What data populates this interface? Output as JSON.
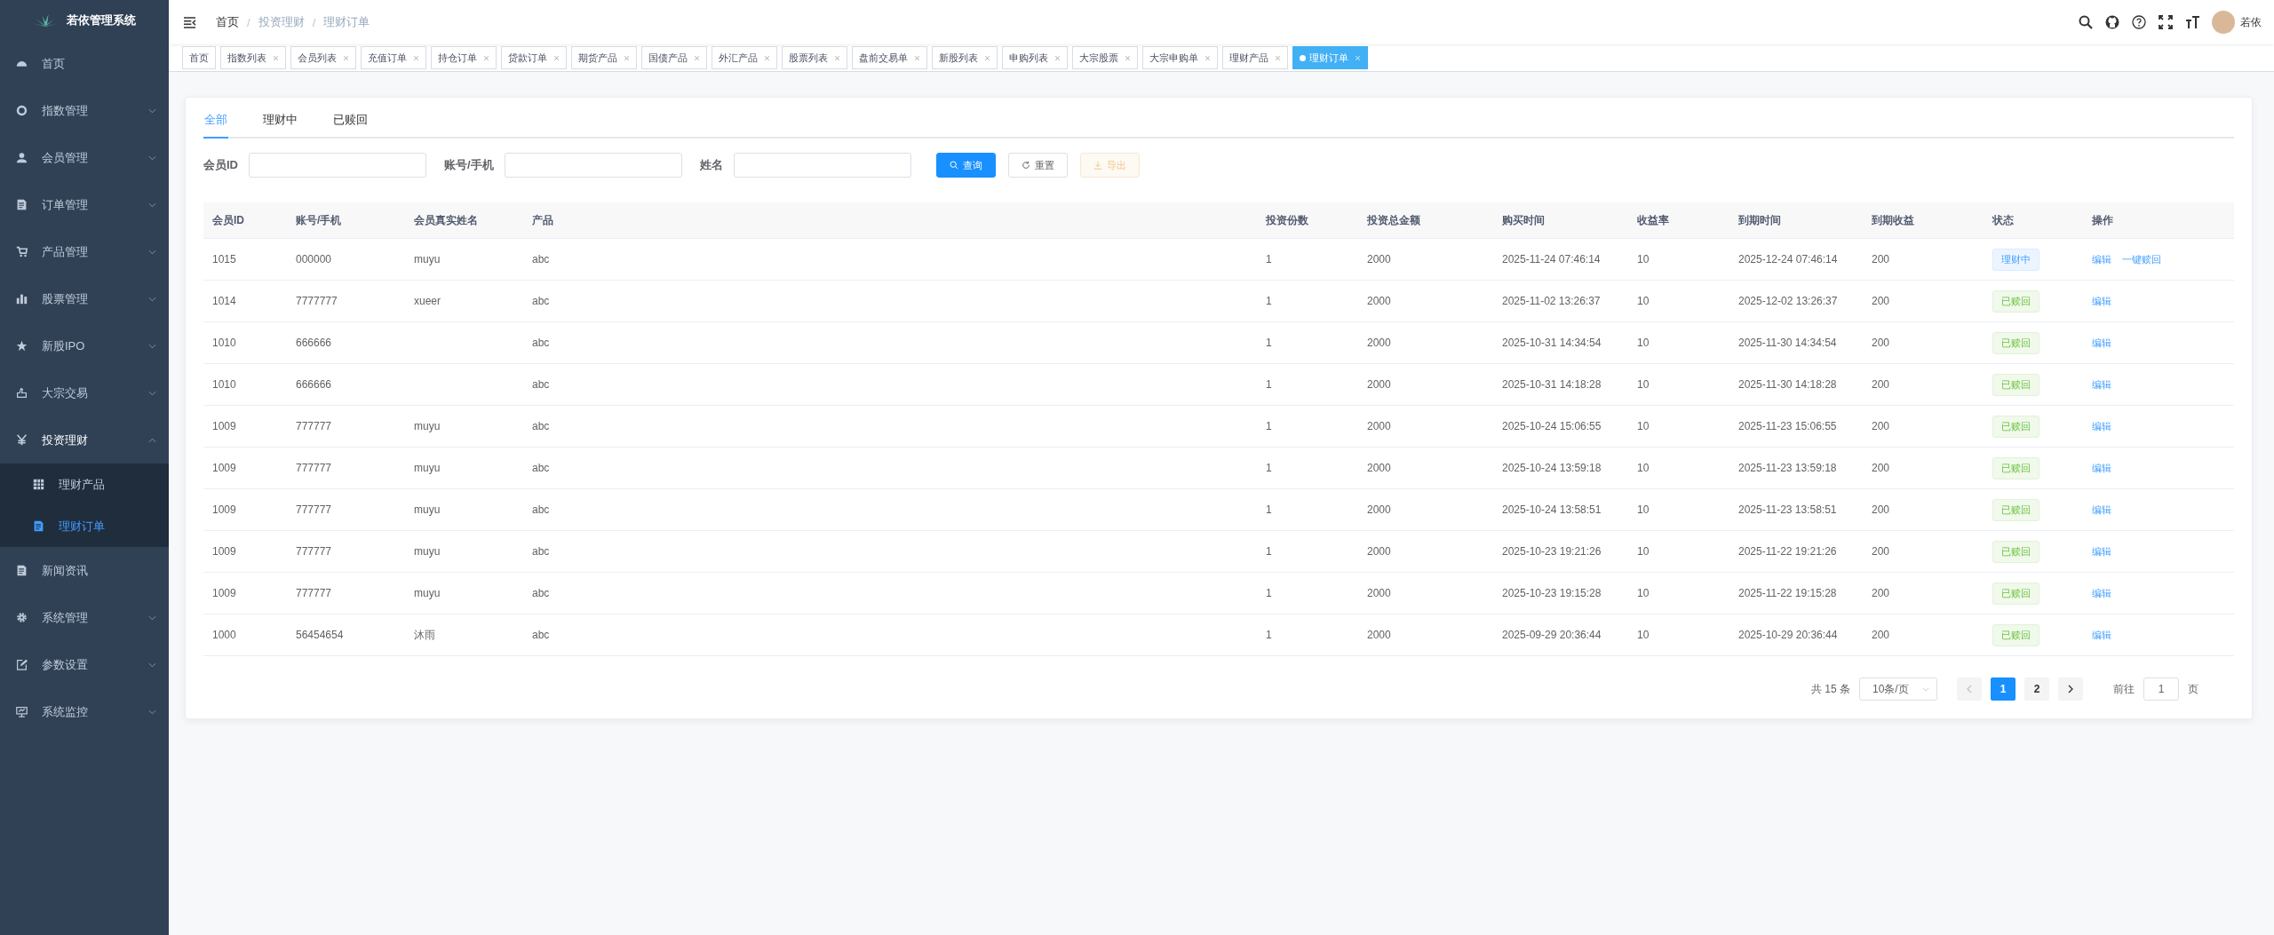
{
  "app": {
    "title": "若依管理系统"
  },
  "sidebar": {
    "items": [
      {
        "label": "首页",
        "expandable": false,
        "expanded": false
      },
      {
        "label": "指数管理",
        "expandable": true,
        "expanded": false
      },
      {
        "label": "会员管理",
        "expandable": true,
        "expanded": false
      },
      {
        "label": "订单管理",
        "expandable": true,
        "expanded": false
      },
      {
        "label": "产品管理",
        "expandable": true,
        "expanded": false
      },
      {
        "label": "股票管理",
        "expandable": true,
        "expanded": false
      },
      {
        "label": "新股IPO",
        "expandable": true,
        "expanded": false
      },
      {
        "label": "大宗交易",
        "expandable": true,
        "expanded": false
      },
      {
        "label": "投资理财",
        "expandable": true,
        "expanded": true,
        "children": [
          {
            "label": "理财产品",
            "selected": false
          },
          {
            "label": "理财订单",
            "selected": true
          }
        ]
      },
      {
        "label": "新闻资讯",
        "expandable": false,
        "expanded": false
      },
      {
        "label": "系统管理",
        "expandable": true,
        "expanded": false
      },
      {
        "label": "参数设置",
        "expandable": true,
        "expanded": false
      },
      {
        "label": "系统监控",
        "expandable": true,
        "expanded": false
      }
    ]
  },
  "breadcrumb": {
    "separator": "/",
    "items": [
      "首页",
      "投资理财",
      "理财订单"
    ]
  },
  "user": {
    "name": "若依"
  },
  "tags": [
    {
      "label": "首页",
      "closable": false,
      "selected": false
    },
    {
      "label": "指数列表",
      "closable": true,
      "selected": false
    },
    {
      "label": "会员列表",
      "closable": true,
      "selected": false
    },
    {
      "label": "充值订单",
      "closable": true,
      "selected": false
    },
    {
      "label": "持仓订单",
      "closable": true,
      "selected": false
    },
    {
      "label": "贷款订单",
      "closable": true,
      "selected": false
    },
    {
      "label": "期货产品",
      "closable": true,
      "selected": false
    },
    {
      "label": "国债产品",
      "closable": true,
      "selected": false
    },
    {
      "label": "外汇产品",
      "closable": true,
      "selected": false
    },
    {
      "label": "股票列表",
      "closable": true,
      "selected": false
    },
    {
      "label": "盘前交易单",
      "closable": true,
      "selected": false
    },
    {
      "label": "新股列表",
      "closable": true,
      "selected": false
    },
    {
      "label": "申购列表",
      "closable": true,
      "selected": false
    },
    {
      "label": "大宗股票",
      "closable": true,
      "selected": false
    },
    {
      "label": "大宗申购单",
      "closable": true,
      "selected": false
    },
    {
      "label": "理财产品",
      "closable": true,
      "selected": false
    },
    {
      "label": "理财订单",
      "closable": true,
      "selected": true
    }
  ],
  "tabs": [
    {
      "label": "全部",
      "selected": true
    },
    {
      "label": "理财中",
      "selected": false
    },
    {
      "label": "已赎回",
      "selected": false
    }
  ],
  "filters": [
    {
      "label": "会员ID"
    },
    {
      "label": "账号/手机"
    },
    {
      "label": "姓名"
    }
  ],
  "buttons": [
    {
      "label": "查询",
      "kind": "primary"
    },
    {
      "label": "重置",
      "kind": "default"
    },
    {
      "label": "导出",
      "kind": "warning"
    }
  ],
  "table": {
    "columns": [
      "会员ID",
      "账号/手机",
      "会员真实姓名",
      "产品",
      "投资份数",
      "投资总金额",
      "购买时间",
      "收益率",
      "到期时间",
      "到期收益",
      "状态",
      "操作"
    ],
    "rows": [
      {
        "cells": [
          "1015",
          "000000",
          "muyu",
          "abc",
          "1",
          "2000",
          "2025-11-24 07:46:14",
          "10",
          "2025-12-24 07:46:14",
          "200"
        ],
        "status": {
          "label": "理财中",
          "kind": "active"
        },
        "actions": [
          "编辑",
          "一键赎回"
        ]
      },
      {
        "cells": [
          "1014",
          "7777777",
          "xueer",
          "abc",
          "1",
          "2000",
          "2025-11-02 13:26:37",
          "10",
          "2025-12-02 13:26:37",
          "200"
        ],
        "status": {
          "label": "已赎回",
          "kind": "redeemed"
        },
        "actions": [
          "编辑"
        ]
      },
      {
        "cells": [
          "1010",
          "666666",
          "",
          "abc",
          "1",
          "2000",
          "2025-10-31 14:34:54",
          "10",
          "2025-11-30 14:34:54",
          "200"
        ],
        "status": {
          "label": "已赎回",
          "kind": "redeemed"
        },
        "actions": [
          "编辑"
        ]
      },
      {
        "cells": [
          "1010",
          "666666",
          "",
          "abc",
          "1",
          "2000",
          "2025-10-31 14:18:28",
          "10",
          "2025-11-30 14:18:28",
          "200"
        ],
        "status": {
          "label": "已赎回",
          "kind": "redeemed"
        },
        "actions": [
          "编辑"
        ]
      },
      {
        "cells": [
          "1009",
          "777777",
          "muyu",
          "abc",
          "1",
          "2000",
          "2025-10-24 15:06:55",
          "10",
          "2025-11-23 15:06:55",
          "200"
        ],
        "status": {
          "label": "已赎回",
          "kind": "redeemed"
        },
        "actions": [
          "编辑"
        ]
      },
      {
        "cells": [
          "1009",
          "777777",
          "muyu",
          "abc",
          "1",
          "2000",
          "2025-10-24 13:59:18",
          "10",
          "2025-11-23 13:59:18",
          "200"
        ],
        "status": {
          "label": "已赎回",
          "kind": "redeemed"
        },
        "actions": [
          "编辑"
        ]
      },
      {
        "cells": [
          "1009",
          "777777",
          "muyu",
          "abc",
          "1",
          "2000",
          "2025-10-24 13:58:51",
          "10",
          "2025-11-23 13:58:51",
          "200"
        ],
        "status": {
          "label": "已赎回",
          "kind": "redeemed"
        },
        "actions": [
          "编辑"
        ]
      },
      {
        "cells": [
          "1009",
          "777777",
          "muyu",
          "abc",
          "1",
          "2000",
          "2025-10-23 19:21:26",
          "10",
          "2025-11-22 19:21:26",
          "200"
        ],
        "status": {
          "label": "已赎回",
          "kind": "redeemed"
        },
        "actions": [
          "编辑"
        ]
      },
      {
        "cells": [
          "1009",
          "777777",
          "muyu",
          "abc",
          "1",
          "2000",
          "2025-10-23 19:15:28",
          "10",
          "2025-11-22 19:15:28",
          "200"
        ],
        "status": {
          "label": "已赎回",
          "kind": "redeemed"
        },
        "actions": [
          "编辑"
        ]
      },
      {
        "cells": [
          "1000",
          "56454654",
          "沐雨",
          "abc",
          "1",
          "2000",
          "2025-09-29 20:36:44",
          "10",
          "2025-10-29 20:36:44",
          "200"
        ],
        "status": {
          "label": "已赎回",
          "kind": "redeemed"
        },
        "actions": [
          "编辑"
        ]
      }
    ]
  },
  "pagination": {
    "total": "共 15 条",
    "page_size": "10条/页",
    "prev_disabled": true,
    "next_disabled": false,
    "pages": [
      {
        "label": "1",
        "selected": true
      },
      {
        "label": "2",
        "selected": false
      }
    ],
    "goto_label": "前往",
    "goto_value": "1",
    "goto_suffix": "页"
  }
}
